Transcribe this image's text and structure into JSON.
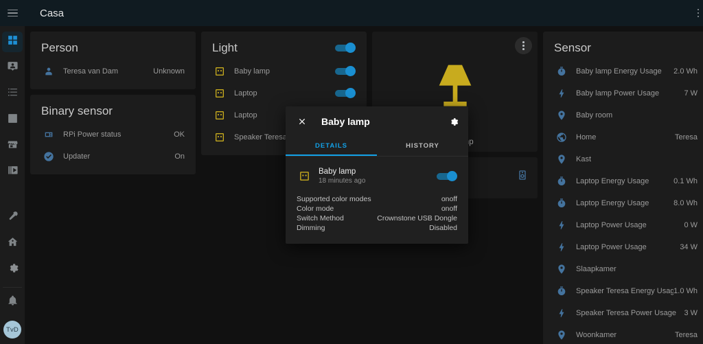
{
  "sidebar": {
    "menu_icon": "hamburger-icon",
    "items": [
      {
        "label": "Overview",
        "icon": "dashboard-grid-icon",
        "active": true
      },
      {
        "label": "Map",
        "icon": "account-badge-icon",
        "active": false
      },
      {
        "label": "Logbook",
        "icon": "list-icon",
        "active": false
      },
      {
        "label": "History",
        "icon": "chart-bar-icon",
        "active": false
      },
      {
        "label": "HACS",
        "icon": "hacs-store-icon",
        "active": false
      },
      {
        "label": "Media",
        "icon": "media-player-icon",
        "active": false
      }
    ],
    "bottom_items": [
      {
        "label": "Developer tools",
        "icon": "hammer-icon"
      },
      {
        "label": "Supervisor",
        "icon": "home-assistant-icon"
      },
      {
        "label": "Configuration",
        "icon": "gear-icon"
      }
    ],
    "notifications": {
      "label": "Notifications",
      "icon": "bell-icon"
    },
    "user": {
      "initials": "TvD",
      "label": "user-avatar"
    }
  },
  "header": {
    "title": "Casa",
    "overflow_icon": "kebab-menu-icon"
  },
  "cards": {
    "person": {
      "title": "Person",
      "rows": [
        {
          "icon": "account-icon",
          "name": "Teresa van Dam",
          "state": "Unknown"
        }
      ]
    },
    "binary_sensor": {
      "title": "Binary sensor",
      "rows": [
        {
          "icon": "raspberry-pi-icon",
          "name": "RPi Power status",
          "state": "OK"
        },
        {
          "icon": "check-circle-icon",
          "name": "Updater",
          "state": "On"
        }
      ]
    },
    "light": {
      "title": "Light",
      "header_toggle": true,
      "rows": [
        {
          "icon": "power-socket-icon",
          "name": "Baby lamp",
          "toggle": true
        },
        {
          "icon": "power-socket-icon",
          "name": "Laptop",
          "toggle": true
        },
        {
          "icon": "power-socket-icon",
          "name": "Laptop",
          "toggle": true
        },
        {
          "icon": "power-socket-icon",
          "name": "Speaker Teresa",
          "toggle": true
        }
      ]
    },
    "picture_entity": {
      "label": "Baby lamp",
      "icon": "lamp-icon",
      "overflow_icon": "kebab-menu-icon"
    },
    "media_player": {
      "icon": "speaker-icon"
    },
    "sensor": {
      "title": "Sensor",
      "rows": [
        {
          "icon": "gauge-icon",
          "name": "Baby lamp Energy Usage",
          "state": "2.0 Wh"
        },
        {
          "icon": "flash-icon",
          "name": "Baby lamp Power Usage",
          "state": "7 W"
        },
        {
          "icon": "map-marker-icon",
          "name": "Baby room",
          "state": ""
        },
        {
          "icon": "earth-icon",
          "name": "Home",
          "state": "Teresa"
        },
        {
          "icon": "map-marker-icon",
          "name": "Kast",
          "state": ""
        },
        {
          "icon": "gauge-icon",
          "name": "Laptop Energy Usage",
          "state": "0.1 Wh"
        },
        {
          "icon": "gauge-icon",
          "name": "Laptop Energy Usage",
          "state": "8.0 Wh"
        },
        {
          "icon": "flash-icon",
          "name": "Laptop Power Usage",
          "state": "0 W"
        },
        {
          "icon": "flash-icon",
          "name": "Laptop Power Usage",
          "state": "34 W"
        },
        {
          "icon": "map-marker-icon",
          "name": "Slaapkamer",
          "state": ""
        },
        {
          "icon": "gauge-icon",
          "name": "Speaker Teresa Energy Usage",
          "state": "1.0 Wh"
        },
        {
          "icon": "flash-icon",
          "name": "Speaker Teresa Power Usage",
          "state": "3 W"
        },
        {
          "icon": "map-marker-icon",
          "name": "Woonkamer",
          "state": "Teresa"
        }
      ]
    }
  },
  "dialog": {
    "title": "Baby lamp",
    "close_icon": "close-icon",
    "settings_icon": "gear-icon",
    "tabs": [
      {
        "label": "DETAILS",
        "active": true
      },
      {
        "label": "HISTORY",
        "active": false
      }
    ],
    "entity": {
      "icon": "power-socket-icon",
      "name": "Baby lamp",
      "last_changed": "18 minutes ago",
      "toggle": true
    },
    "attributes": [
      {
        "key": "Supported color modes",
        "value": "onoff"
      },
      {
        "key": "Color mode",
        "value": "onoff"
      },
      {
        "key": "Switch Method",
        "value": "Crownstone USB Dongle"
      },
      {
        "key": "Dimming",
        "value": "Disabled"
      }
    ]
  },
  "colors": {
    "accent": "#12a1e8",
    "toggle_on": "#1a8fd1",
    "icon_yellow": "#c8ab1e",
    "icon_blue": "#44739e",
    "background": "#111111",
    "card": "#1c1c1c",
    "header": "#101b21"
  }
}
